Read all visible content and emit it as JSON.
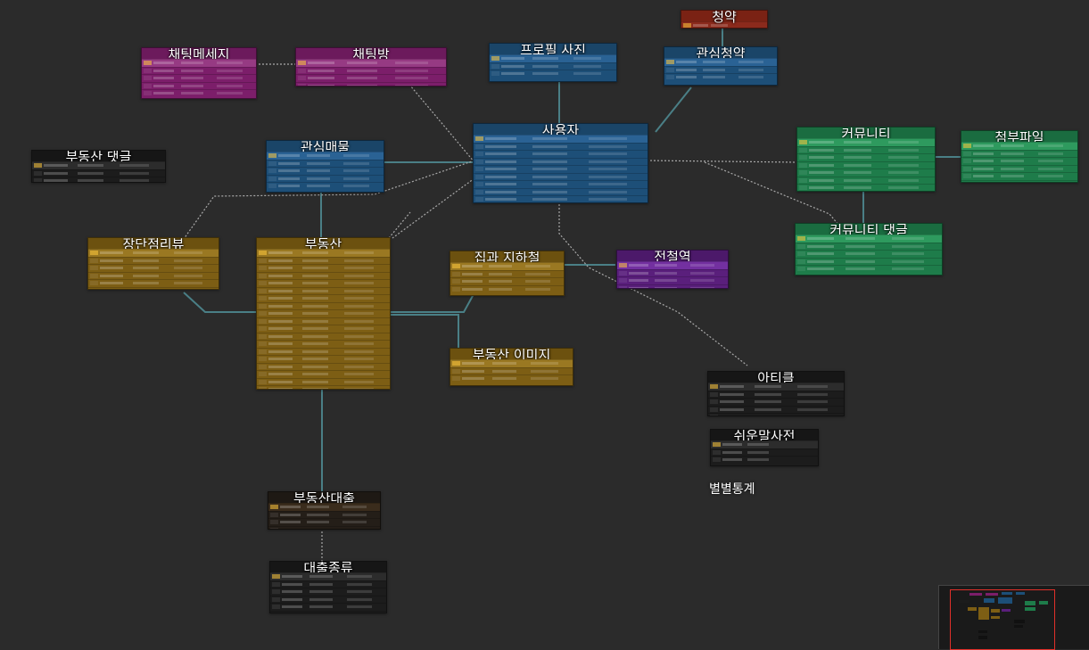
{
  "diagram": {
    "tables": [
      {
        "id": "t_chat_msg",
        "title": "채팅메세지",
        "theme": "mag",
        "rows": 5
      },
      {
        "id": "t_chat_room",
        "title": "채팅방",
        "theme": "mag",
        "rows": 4
      },
      {
        "id": "t_profile",
        "title": "프로필 사진",
        "theme": "blue",
        "rows": 3
      },
      {
        "id": "t_contract",
        "title": "청약",
        "theme": "red",
        "rows": 1
      },
      {
        "id": "t_fav_contract",
        "title": "관심청약",
        "theme": "blue",
        "rows": 3
      },
      {
        "id": "t_user",
        "title": "사용자",
        "theme": "blue",
        "rows": 12
      },
      {
        "id": "t_fav_listing",
        "title": "관심매물",
        "theme": "blue",
        "rows": 5
      },
      {
        "id": "t_re_comment",
        "title": "부동산 댓글",
        "theme": "black",
        "rows": 3
      },
      {
        "id": "t_community",
        "title": "커뮤니티",
        "theme": "green",
        "rows": 8
      },
      {
        "id": "t_attach",
        "title": "첨부파일",
        "theme": "green",
        "rows": 6
      },
      {
        "id": "t_comm_comment",
        "title": "커뮤니티 댓글",
        "theme": "green",
        "rows": 5
      },
      {
        "id": "t_review",
        "title": "장단점리뷰",
        "theme": "orange",
        "rows": 6
      },
      {
        "id": "t_realestate",
        "title": "부동산",
        "theme": "orange",
        "rows": 22
      },
      {
        "id": "t_house_subway",
        "title": "집과 지하철",
        "theme": "orange",
        "rows": 4
      },
      {
        "id": "t_subway",
        "title": "전철역",
        "theme": "purple",
        "rows": 4
      },
      {
        "id": "t_re_image",
        "title": "부동산 이미지",
        "theme": "orange",
        "rows": 3
      },
      {
        "id": "t_article",
        "title": "아티클",
        "theme": "black",
        "rows": 6
      },
      {
        "id": "t_glossary",
        "title": "쉬운말사전",
        "theme": "black",
        "rows": 3
      },
      {
        "id": "t_loan",
        "title": "부동산대출",
        "theme": "dkbrown",
        "rows": 5
      },
      {
        "id": "t_loan_type",
        "title": "대출종류",
        "theme": "black",
        "rows": 7
      }
    ],
    "free_labels": [
      {
        "id": "l_stats",
        "text": "별별통계"
      }
    ]
  },
  "colors": {
    "background": "#2b2b2b",
    "blue": "#1d4f78",
    "magenta": "#7c1e6a",
    "red": "#8b2a1c",
    "green": "#1e7c4a",
    "orange": "#7d5e14",
    "purple": "#5a1f7c",
    "black": "#1c1c1c",
    "connector": "#4a7f86",
    "connector_dashed": "#a9a9a9",
    "minimap_viewport": "#e0302a"
  },
  "minimap": {
    "present": true
  }
}
